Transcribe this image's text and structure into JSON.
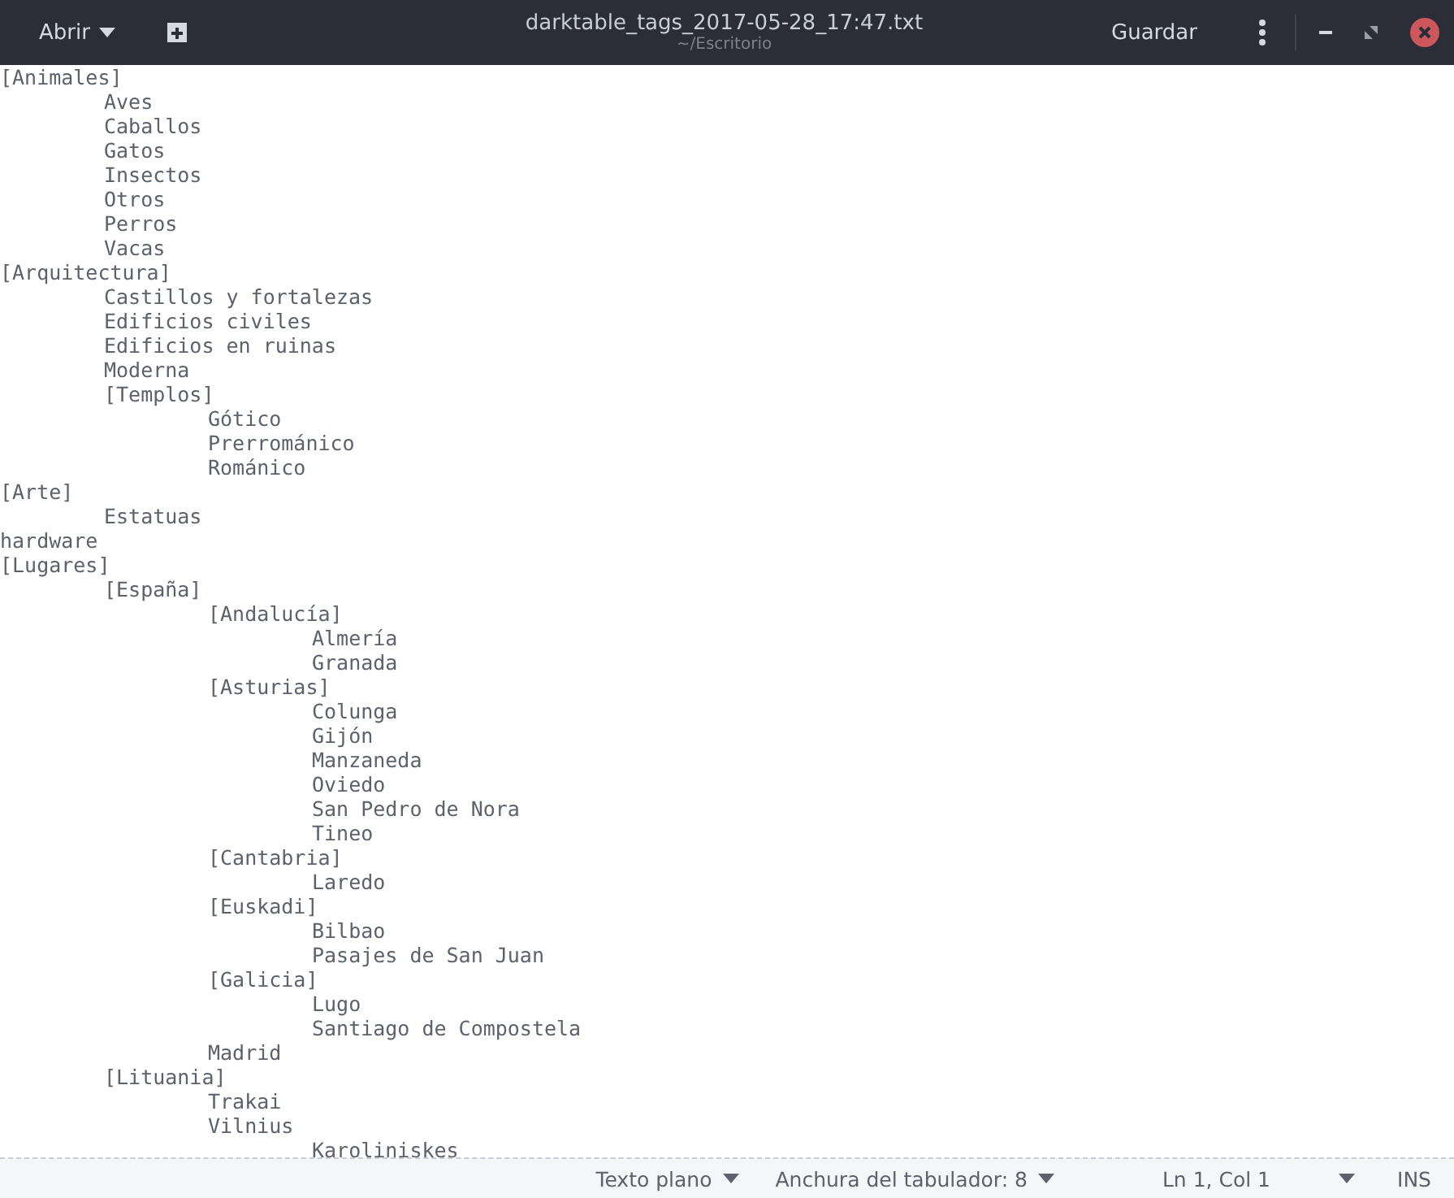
{
  "header": {
    "open_button": "Abrir",
    "title": "darktable_tags_2017-05-28_17:47.txt",
    "subtitle": "~/Escritorio",
    "save_button": "Guardar"
  },
  "document": {
    "lines": [
      {
        "text": "[Animales]",
        "children": [
          {
            "text": "Aves"
          },
          {
            "text": "Caballos"
          },
          {
            "text": "Gatos"
          },
          {
            "text": "Insectos"
          },
          {
            "text": "Otros"
          },
          {
            "text": "Perros"
          },
          {
            "text": "Vacas"
          }
        ]
      },
      {
        "text": "[Arquitectura]",
        "children": [
          {
            "text": "Castillos y fortalezas"
          },
          {
            "text": "Edificios civiles"
          },
          {
            "text": "Edificios en ruinas"
          },
          {
            "text": "Moderna"
          },
          {
            "text": "[Templos]",
            "children": [
              {
                "text": "Gótico"
              },
              {
                "text": "Prerrománico"
              },
              {
                "text": "Románico"
              }
            ]
          }
        ]
      },
      {
        "text": "[Arte]",
        "children": [
          {
            "text": "Estatuas"
          }
        ]
      },
      {
        "text": "hardware"
      },
      {
        "text": "[Lugares]",
        "children": [
          {
            "text": "[España]",
            "children": [
              {
                "text": "[Andalucía]",
                "children": [
                  {
                    "text": "Almería"
                  },
                  {
                    "text": "Granada"
                  }
                ]
              },
              {
                "text": "[Asturias]",
                "children": [
                  {
                    "text": "Colunga"
                  },
                  {
                    "text": "Gijón"
                  },
                  {
                    "text": "Manzaneda"
                  },
                  {
                    "text": "Oviedo"
                  },
                  {
                    "text": "San Pedro de Nora"
                  },
                  {
                    "text": "Tineo"
                  }
                ]
              },
              {
                "text": "[Cantabria]",
                "children": [
                  {
                    "text": "Laredo"
                  }
                ]
              },
              {
                "text": "[Euskadi]",
                "children": [
                  {
                    "text": "Bilbao"
                  },
                  {
                    "text": "Pasajes de San Juan"
                  }
                ]
              },
              {
                "text": "[Galicia]",
                "children": [
                  {
                    "text": "Lugo"
                  },
                  {
                    "text": "Santiago de Compostela"
                  }
                ]
              },
              {
                "text": "Madrid"
              }
            ]
          },
          {
            "text": "[Lituania]",
            "children": [
              {
                "text": "Trakai"
              },
              {
                "text": "Vilnius",
                "children": [
                  {
                    "text": "Karoliniskes"
                  }
                ]
              }
            ]
          }
        ]
      }
    ]
  },
  "status_bar": {
    "language": "Texto plano",
    "tab_width": "Anchura del tabulador: 8",
    "position": "Ln 1, Col 1",
    "mode": "INS"
  }
}
